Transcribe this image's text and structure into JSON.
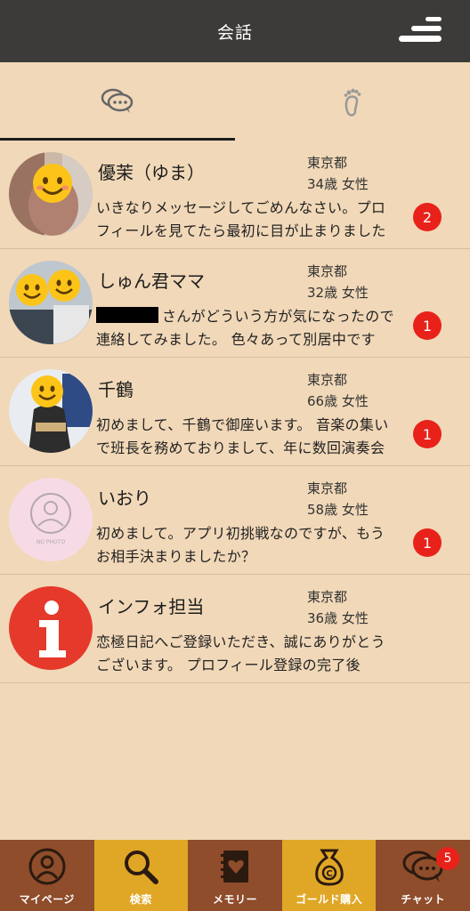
{
  "header": {
    "title": "会話"
  },
  "tabs": [
    {
      "name": "conversation",
      "icon": "chat-bubbles-icon",
      "active": true
    },
    {
      "name": "footprints",
      "icon": "footprint-icon",
      "active": false
    }
  ],
  "conversations": [
    {
      "name": "優茉（ゆま）",
      "prefecture": "東京都",
      "age_gender": "34歳 女性",
      "message": "いきなりメッセージしてごめんなさい。プロフィールを見てたら最初に目が止まりました",
      "unread": "2"
    },
    {
      "name": "しゅん君ママ",
      "prefecture": "東京都",
      "age_gender": "32歳 女性",
      "message_after_redaction": "さんがどういう方が気になったので連絡してみました。 色々あって別居中です",
      "unread": "1"
    },
    {
      "name": "千鶴",
      "prefecture": "東京都",
      "age_gender": "66歳 女性",
      "message": "初めまして、千鶴で御座います。 音楽の集いで班長を務めておりまして、年に数回演奏会",
      "unread": "1"
    },
    {
      "name": "いおり",
      "prefecture": "東京都",
      "age_gender": "58歳 女性",
      "message": "初めまして。アプリ初挑戦なのですが、もうお相手決まりましたか？",
      "unread": "1",
      "avatar_text": "NO PHOTO"
    },
    {
      "name": "インフォ担当",
      "prefecture": "東京都",
      "age_gender": "36歳 女性",
      "message": "恋極日記へご登録いただき、誠にありがとうございます。 プロフィール登録の完了後",
      "unread": ""
    }
  ],
  "bottom_nav": [
    {
      "label": "マイページ",
      "icon": "person-icon",
      "color": "#8f4d2b"
    },
    {
      "label": "検索",
      "icon": "magnifier-icon",
      "color": "#e0a726"
    },
    {
      "label": "メモリー",
      "icon": "heart-notebook-icon",
      "color": "#8f4d2b"
    },
    {
      "label": "ゴールド購入",
      "icon": "coin-bag-icon",
      "color": "#e0a726"
    },
    {
      "label": "チャット",
      "icon": "chat-icon",
      "color": "#8f4d2b",
      "badge": "5"
    }
  ],
  "colors": {
    "header_bg": "#3d3b39",
    "page_bg": "#f1d8b8",
    "badge": "#e8221a"
  }
}
